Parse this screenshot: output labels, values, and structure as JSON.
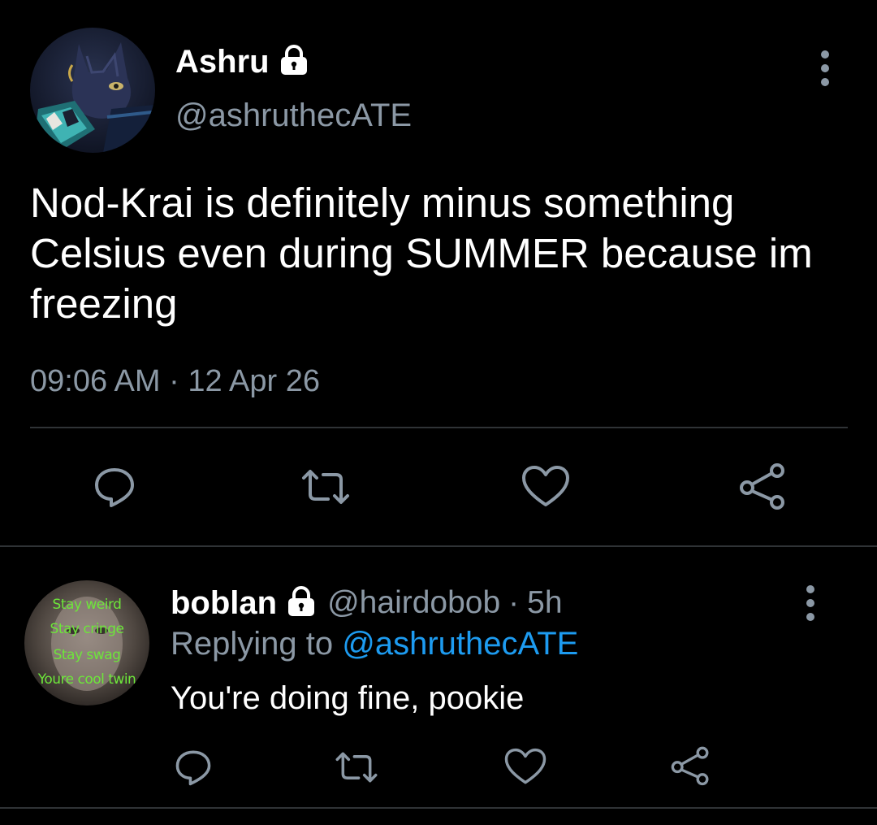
{
  "main_tweet": {
    "display_name": "Ashru",
    "handle": "@ashruthecATE",
    "text": "Nod-Krai is definitely minus something Celsius even during SUMMER because im freezing",
    "timestamp": "09:06 AM · 12 Apr 26",
    "avatar_icon": "cat-avatar",
    "lock_icon": "lock-icon",
    "actions": [
      "reply-icon",
      "retweet-icon",
      "like-icon",
      "share-icon"
    ]
  },
  "reply_tweet": {
    "display_name": "boblan",
    "handle": "@hairdobob",
    "separator": "·",
    "time": "5h",
    "replying_prefix": "Replying to ",
    "replying_handle": "@ashruthecATE",
    "text": "You're doing fine, pookie",
    "avatar_caption": [
      "Stay weird",
      "Stay cringe",
      "Stay swag",
      "Youre cool twin"
    ],
    "actions": [
      "reply-icon",
      "retweet-icon",
      "like-icon",
      "share-icon"
    ]
  },
  "colors": {
    "background": "#000000",
    "text": "#ffffff",
    "secondary": "#8b98a5",
    "link": "#1d9bf0",
    "divider": "#2f3336",
    "icon": "#8b98a5"
  }
}
